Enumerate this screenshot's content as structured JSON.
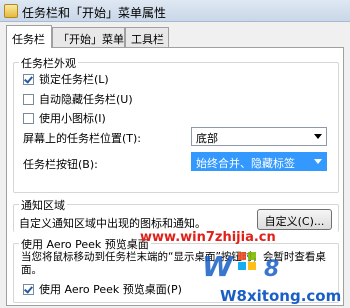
{
  "window": {
    "title": "任务栏和「开始」菜单属性"
  },
  "tabs": [
    {
      "label": "任务栏"
    },
    {
      "label": "「开始」菜单"
    },
    {
      "label": "工具栏"
    }
  ],
  "appearance": {
    "legend": "任务栏外观",
    "lock_taskbar": "锁定任务栏(L)",
    "auto_hide": "自动隐藏任务栏(U)",
    "small_icons": "使用小图标(I)",
    "location_label": "屏幕上的任务栏位置(T):",
    "location_value": "底部",
    "buttons_label": "任务栏按钮(B):",
    "buttons_value": "始终合并、隐藏标签"
  },
  "notification": {
    "legend": "通知区域",
    "description": "自定义通知区域中出现的图标和通知。",
    "customize_button": "自定义(C)..."
  },
  "aero_peek": {
    "legend": "使用 Aero Peek 预览桌面",
    "description": "当您将鼠标移动到任务栏末端的“显示桌面”按钮时，会暂时查看桌面。",
    "checkbox": "使用 Aero Peek 预览桌面(P)"
  },
  "watermark": {
    "site": "www.win7zhijia.cn",
    "logo": "W8xitong.com"
  },
  "colors": {
    "accent": "#3399ff",
    "watermark_red": "#e0201a",
    "watermark_blue": "#1a5fc6"
  }
}
